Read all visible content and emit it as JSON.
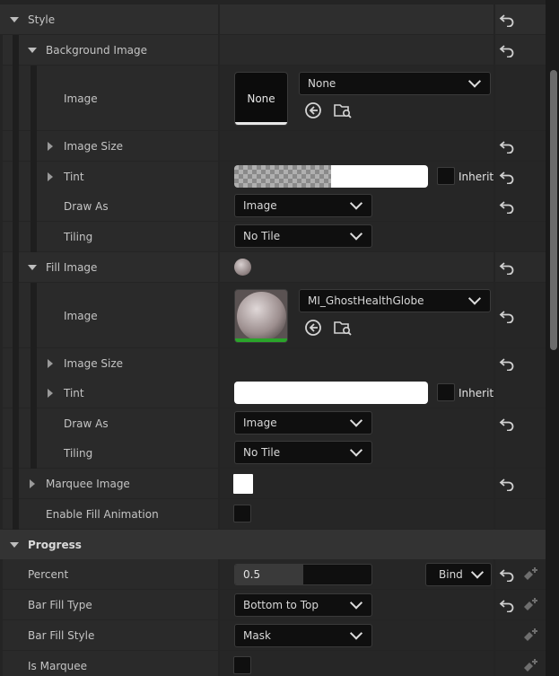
{
  "style": {
    "title": "Style",
    "background_image": {
      "title": "Background Image",
      "image_label": "Image",
      "image_thumb_text": "None",
      "image_value": "None",
      "image_size_label": "Image Size",
      "tint_label": "Tint",
      "inherit_label": "Inherit",
      "draw_as_label": "Draw As",
      "draw_as_value": "Image",
      "tiling_label": "Tiling",
      "tiling_value": "No Tile"
    },
    "fill_image": {
      "title": "Fill Image",
      "image_label": "Image",
      "image_value": "MI_GhostHealthGlobe",
      "image_size_label": "Image Size",
      "tint_label": "Tint",
      "inherit_label": "Inherit",
      "draw_as_label": "Draw As",
      "draw_as_value": "Image",
      "tiling_label": "Tiling",
      "tiling_value": "No Tile"
    },
    "marquee_image_label": "Marquee Image",
    "enable_fill_animation_label": "Enable Fill Animation"
  },
  "progress": {
    "title": "Progress",
    "percent_label": "Percent",
    "percent_value": "0.5",
    "percent_fraction": 0.5,
    "bind_label": "Bind",
    "bar_fill_type_label": "Bar Fill Type",
    "bar_fill_type_value": "Bottom to Top",
    "bar_fill_style_label": "Bar Fill Style",
    "bar_fill_style_value": "Mask",
    "is_marquee_label": "Is Marquee"
  },
  "colors": {
    "accent_green": "#2aa52a",
    "tint_white": "#ffffff"
  },
  "icons": {
    "reset": "reset-arrow-icon",
    "browse": "browse-arrow-icon",
    "find": "find-in-browser-icon",
    "add_binding": "add-binding-icon"
  }
}
